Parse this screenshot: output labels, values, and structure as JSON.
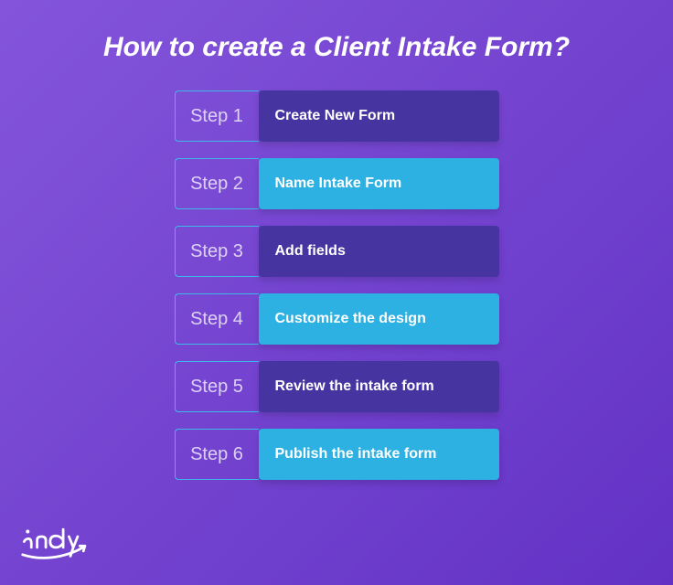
{
  "title": "How to create a Client Intake Form?",
  "steps": [
    {
      "label": "Step 1",
      "description": "Create New Form",
      "variant": "purple"
    },
    {
      "label": "Step 2",
      "description": "Name Intake Form",
      "variant": "cyan"
    },
    {
      "label": "Step 3",
      "description": "Add fields",
      "variant": "purple"
    },
    {
      "label": "Step 4",
      "description": "Customize the design",
      "variant": "cyan"
    },
    {
      "label": "Step 5",
      "description": "Review the intake form",
      "variant": "purple"
    },
    {
      "label": "Step 6",
      "description": "Publish the intake form",
      "variant": "cyan"
    }
  ],
  "logo_text": "indy"
}
